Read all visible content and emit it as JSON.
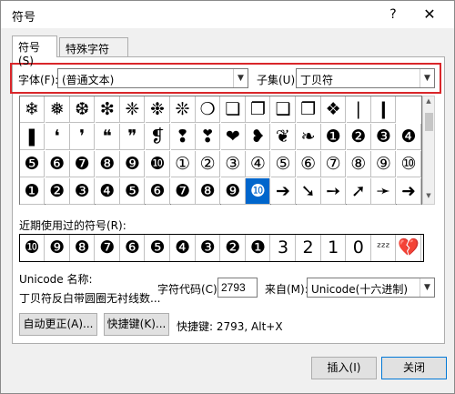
{
  "window": {
    "title": "符号",
    "help": "?",
    "close": "✕"
  },
  "tabs": [
    {
      "label": "符号(S)"
    },
    {
      "label": "特殊字符(P)"
    }
  ],
  "font": {
    "label": "字体(F):",
    "value": "(普通文本)"
  },
  "subset": {
    "label": "子集(U):",
    "value": "丁贝符"
  },
  "grid": [
    [
      "❄",
      "❅",
      "❆",
      "❇",
      "❈",
      "❉",
      "❊",
      "❍",
      "❏",
      "❐",
      "❑",
      "❒",
      "❖",
      "❘",
      "❙"
    ],
    [
      "❚",
      "❛",
      "❜",
      "❝",
      "❞",
      "❡",
      "❢",
      "❣",
      "❤",
      "❥",
      "❦",
      "❧",
      "❶",
      "❷",
      "❸",
      "❹"
    ],
    [
      "❺",
      "❻",
      "❼",
      "❽",
      "❾",
      "❿",
      "①",
      "②",
      "③",
      "④",
      "⑤",
      "⑥",
      "⑦",
      "⑧",
      "⑨",
      "⑩"
    ],
    [
      "❶",
      "❷",
      "❸",
      "❹",
      "❺",
      "❻",
      "❼",
      "❽",
      "❾",
      "❿",
      "➔",
      "➘",
      "➙",
      "➚",
      "➛",
      "➜"
    ]
  ],
  "selected": {
    "row": 3,
    "col": 9
  },
  "recent": {
    "label": "近期使用过的符号(R):",
    "symbols": [
      "❿",
      "❾",
      "❽",
      "❼",
      "❻",
      "❺",
      "❹",
      "❸",
      "❷",
      "❶",
      "3",
      "2",
      "1",
      "0",
      "ᶻᶻᶻ",
      "💔"
    ]
  },
  "unicode_name": {
    "label": "Unicode 名称:",
    "value": "丁贝符反白带圆圈无衬线数..."
  },
  "char_code": {
    "label": "字符代码(C):",
    "value": "2793"
  },
  "from": {
    "label": "来自(M):",
    "value": "Unicode(十六进制)"
  },
  "autocorrect_label": "自动更正(A)...",
  "shortcut_btn_label": "快捷键(K)...",
  "shortcut_text": "快捷键: 2793, Alt+X",
  "insert_label": "插入(I)",
  "close_label": "关闭"
}
